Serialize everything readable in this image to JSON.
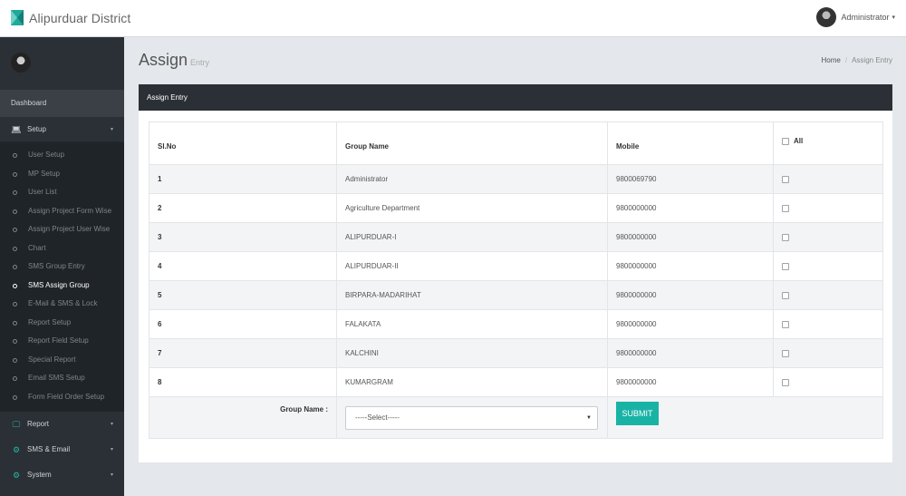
{
  "header": {
    "brand_name": "Alipurduar District",
    "user_name": "Administrator",
    "user_caret": "▾"
  },
  "sidebar": {
    "dashboard_label": "Dashboard",
    "setup": {
      "icon": "laptop-icon",
      "label": "Setup",
      "caret": "▾"
    },
    "setup_items": [
      {
        "label": "User Setup",
        "active": false
      },
      {
        "label": "MP Setup",
        "active": false
      },
      {
        "label": "User List",
        "active": false
      },
      {
        "label": "Assign Project Form Wise",
        "active": false
      },
      {
        "label": "Assign Project User Wise",
        "active": false
      },
      {
        "label": "Chart",
        "active": false
      },
      {
        "label": "SMS Group Entry",
        "active": false
      },
      {
        "label": "SMS Assign Group",
        "active": true
      },
      {
        "label": "E-Mail & SMS & Lock",
        "active": false
      },
      {
        "label": "Report Setup",
        "active": false
      },
      {
        "label": "Report Field Setup",
        "active": false
      },
      {
        "label": "Special Report",
        "active": false
      },
      {
        "label": "Email SMS Setup",
        "active": false
      },
      {
        "label": "Form Field Order Setup",
        "active": false
      }
    ],
    "groups": [
      {
        "icon": "monitor-icon",
        "label": "Report",
        "caret": "▾"
      },
      {
        "icon": "gear-icon",
        "label": "SMS & Email",
        "caret": "▾"
      },
      {
        "icon": "gear-icon",
        "label": "System",
        "caret": "▾"
      }
    ]
  },
  "page": {
    "title": "Assign",
    "subtitle": "Entry",
    "breadcrumb": {
      "home": "Home",
      "separator": "/",
      "current": "Assign Entry"
    }
  },
  "panel": {
    "heading": "Assign Entry",
    "columns": {
      "sl": "Sl.No",
      "group": "Group Name",
      "mobile": "Mobile",
      "all": "All"
    },
    "rows": [
      {
        "sl": "1",
        "group": "Administrator",
        "mobile": "9800069790"
      },
      {
        "sl": "2",
        "group": "Agriculture Department",
        "mobile": "9800000000"
      },
      {
        "sl": "3",
        "group": "ALIPURDUAR-I",
        "mobile": "9800000000"
      },
      {
        "sl": "4",
        "group": "ALIPURDUAR-II",
        "mobile": "9800000000"
      },
      {
        "sl": "5",
        "group": "BIRPARA-MADARIHAT",
        "mobile": "9800000000"
      },
      {
        "sl": "6",
        "group": "FALAKATA",
        "mobile": "9800000000"
      },
      {
        "sl": "7",
        "group": "KALCHINI",
        "mobile": "9800000000"
      },
      {
        "sl": "8",
        "group": "KUMARGRAM",
        "mobile": "9800000000"
      }
    ],
    "form": {
      "group_label": "Group Name :",
      "select_value": "-----Select-----",
      "select_arrow": "▼",
      "submit_label": "SUBMIT"
    }
  },
  "colors": {
    "sidebar_bg": "#2a3035",
    "panel_head_bg": "#2a3035",
    "accent": "#19b3a6",
    "content_bg": "#e4e7eb"
  }
}
